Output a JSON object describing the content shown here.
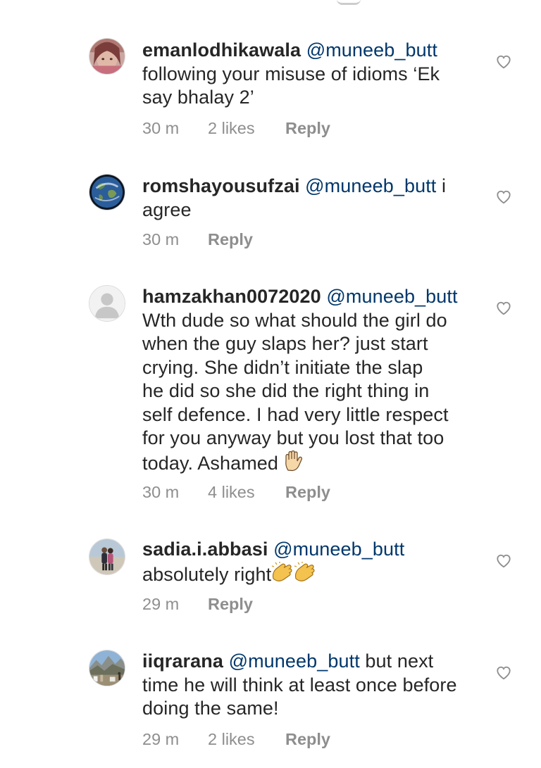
{
  "comments": [
    {
      "username": "emanlodhikawala",
      "mention": "@muneeb_butt",
      "text_lines": [
        "following your misuse of idioms ‘Ek",
        "say bhalay 2’"
      ],
      "time": "30 m",
      "likes": "2 likes",
      "reply": "Reply",
      "avatar": "pink-portrait-photo",
      "icon": "heart-outline-icon"
    },
    {
      "username": "romshayousufzai",
      "mention": "@muneeb_butt",
      "first_line_suffix": "i",
      "text_lines": [
        "agree"
      ],
      "time": "30 m",
      "reply": "Reply",
      "avatar": "earth-globe-photo",
      "icon": "heart-outline-icon"
    },
    {
      "username": "hamzakhan0072020",
      "mention": "@muneeb_butt",
      "text_lines": [
        "Wth dude so what should the girl do",
        "when the guy slaps her? just start",
        "crying. She didn’t initiate the slap",
        "he did so she did the right thing in",
        "self defence. I had very little respect",
        "for you anyway but you lost that too",
        "today. Ashamed"
      ],
      "emoji": "raised-hand",
      "time": "30 m",
      "likes": "4 likes",
      "reply": "Reply",
      "avatar": "default-profile-placeholder",
      "icon": "heart-outline-icon"
    },
    {
      "username": "sadia.i.abbasi",
      "mention": "@muneeb_butt",
      "text_lines": [
        "absolutely right"
      ],
      "emoji": "clapping-hands x2",
      "time": "29 m",
      "reply": "Reply",
      "avatar": "couple-photo",
      "icon": "heart-outline-icon"
    },
    {
      "username": "iiqrarana",
      "mention": "@muneeb_butt",
      "first_line_suffix": "but next",
      "text_lines": [
        "time he will think at least once before",
        "doing the same!"
      ],
      "time": "29 m",
      "likes": "2 likes",
      "reply": "Reply",
      "avatar": "mountain-landscape-photo",
      "icon": "heart-outline-icon"
    }
  ],
  "colors": {
    "text": "#262626",
    "mention": "#00376b",
    "meta": "#8e8e8e",
    "background": "#ffffff"
  }
}
